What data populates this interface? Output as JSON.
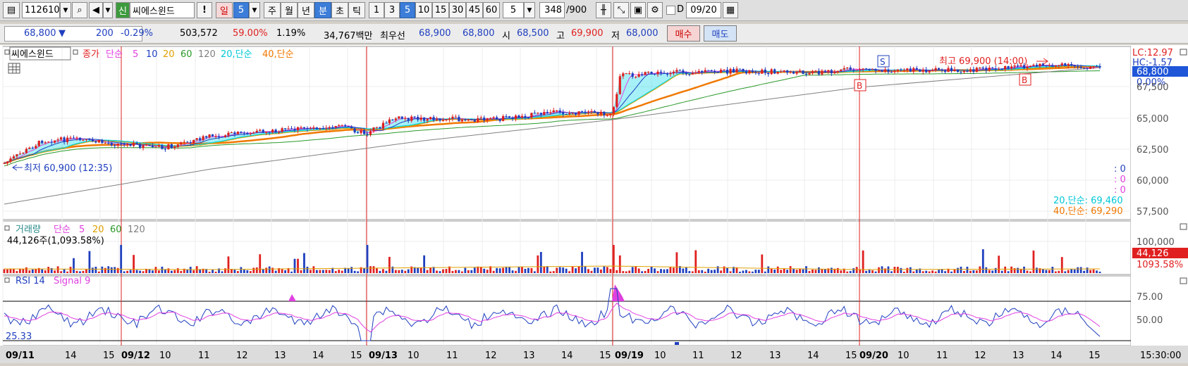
{
  "toolbar": {
    "code": "112610",
    "stock_badge": "신",
    "stock_name": "씨에스윈드",
    "alert_label": "!",
    "period_day": "일",
    "period_day_num": "5",
    "period_week": "주",
    "period_month": "월",
    "period_year": "년",
    "period_minute": "분",
    "period_second": "초",
    "period_tick": "틱",
    "intervals": [
      "1",
      "3",
      "5",
      "10",
      "15",
      "30",
      "45",
      "60"
    ],
    "interval_value": "5",
    "count": "348",
    "count_total": "/900",
    "date_check_label": "D",
    "date": "09/20"
  },
  "quote": {
    "price": "68,800",
    "change_arrow": "▼",
    "change": "200",
    "change_pct": "-0.29%",
    "volume": "503,572",
    "vol_ratio": "59.00%",
    "turnover_ratio": "1.19%",
    "amount": "34,767백만",
    "best_label": "최우선",
    "ask": "68,900",
    "bid": "68,800",
    "open_label": "시",
    "open": "68,500",
    "high_label": "고",
    "high": "69,900",
    "low_label": "저",
    "low": "68,000",
    "buy_label": "매수",
    "sell_label": "매도"
  },
  "price_panel": {
    "stock_label": "씨에스윈드",
    "close_label": "종가",
    "ma_label": "단순",
    "ma_periods": [
      "5",
      "10",
      "20",
      "60",
      "120"
    ],
    "extra_ma1": "20,단순",
    "extra_ma2": "40,단순",
    "high_annotation": "최고 69,900 (14:00)",
    "low_annotation": "최저 60,900 (12:35)",
    "lc": "LC:12.97",
    "hc": "HC:-1.57",
    "current": "68,800",
    "current_pct": "0.00%",
    "y_ticks": [
      "67,500",
      "65,000",
      "62,500",
      "60,000",
      "57,500"
    ],
    "zero_values": [
      ": 0",
      ": 0",
      ": 0"
    ],
    "ma20_value": "20,단순: 69,460",
    "ma40_value": "40,단순: 69,290",
    "signal_s": "S",
    "signal_b": "B"
  },
  "volume_panel": {
    "title": "거래량",
    "ma_label": "단순",
    "ma_periods": [
      "5",
      "20",
      "60",
      "120"
    ],
    "info": "44,126주(1,093.58%)",
    "y_tick": "100,000",
    "current": "44,126",
    "current_pct": "1093.58%"
  },
  "rsi_panel": {
    "title": "RSI 14",
    "signal": "Signal 9",
    "value": "25.33",
    "y_ticks": [
      "75.00",
      "50.00"
    ]
  },
  "x_axis": {
    "labels": [
      "09/11",
      "14",
      "15",
      "09/12",
      "10",
      "11",
      "12",
      "13",
      "14",
      "15",
      "09/13",
      "10",
      "11",
      "12",
      "13",
      "14",
      "15",
      "09/19",
      "10",
      "11",
      "12",
      "13",
      "14",
      "15",
      "09/20",
      "10",
      "11",
      "12",
      "13",
      "14",
      "15"
    ],
    "time": "15:30:00"
  },
  "colors": {
    "up": "#e02020",
    "down": "#1f3fbf",
    "ma5": "#e040e0",
    "ma10": "#1f3fbf",
    "ma20": "#e0a000",
    "ma60": "#2a9a2a",
    "ma120": "#808080",
    "ma20s": "#00d8e8",
    "ma40s": "#f07800"
  }
}
